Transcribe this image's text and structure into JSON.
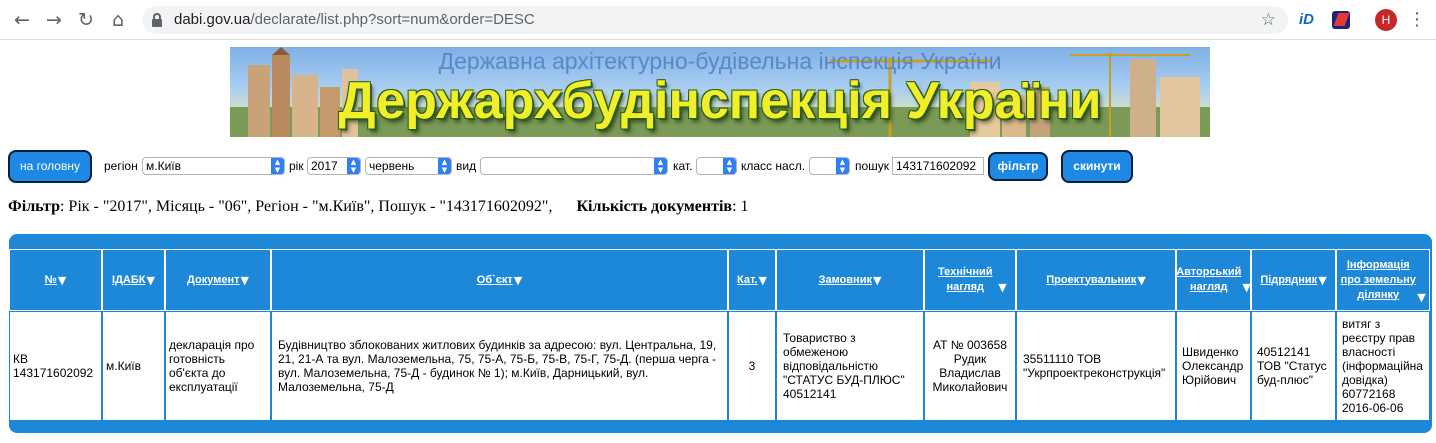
{
  "browser": {
    "url_host": "dabi.gov.ua",
    "url_path": "/declarate/list.php?sort=num&order=DESC",
    "avatar_letter": "H",
    "ext1_label": "iD"
  },
  "banner": {
    "subtitle": "Державна архітектурно-будівельна інспекція України",
    "title": "Держархбудінспекція України"
  },
  "filters": {
    "home_button": "на головну",
    "region_label": "регіон",
    "region_value": "м.Київ",
    "year_label": "рік",
    "year_value": "2017",
    "month_value": "червень",
    "kind_label": "вид",
    "kind_value": "",
    "cat_label": "кат.",
    "cat_value": "",
    "class_label": "класс насл.",
    "class_value": "",
    "search_label": "пошук",
    "search_value": "143171602092",
    "filter_button": "фільтр",
    "reset_button": "скинути"
  },
  "summary": {
    "filter_label": "Фільтр",
    "filter_text": ": Рік - \"2017\", Місяць - \"06\", Регіон - \"м.Київ\", Пошук - \"143171602092\",",
    "count_label": "Кількість документів",
    "count_value": ": 1"
  },
  "table": {
    "headers": [
      {
        "label": "№"
      },
      {
        "label": "ІДАБК"
      },
      {
        "label": "Документ"
      },
      {
        "label": "Об`єкт"
      },
      {
        "label": "Кат."
      },
      {
        "label": "Замовник"
      },
      {
        "label": "Технічний нагляд"
      },
      {
        "label": "Проектувальник"
      },
      {
        "label": "Авторський нагляд"
      },
      {
        "label": "Підрядник"
      },
      {
        "label": "Інформація про земельну ділянку"
      }
    ],
    "rows": [
      [
        "КВ 143171602092",
        "м.Київ",
        "декларація про готовність об'єкта до експлуатації",
        "Будівництво зблокованих житлових будинків за адресою: вул. Центральна, 19, 21, 21-А та вул. Малоземельна, 75, 75-А, 75-Б, 75-В, 75-Г, 75-Д. (перша черга - вул. Малоземельна, 75-Д - будинок № 1); м.Київ, Дарницький, вул. Малоземельна, 75-Д",
        "3",
        "Товариство з обмеженою відповідальністю \"СТАТУС БУД-ПЛЮС\" 40512141",
        "АТ № 003658 Рудик Владислав Миколайович",
        "35511110 ТОВ \"Укрпроектреконструкція\"",
        "Швиденко Олександр Юрійович",
        "40512141 ТОВ \"Статус буд-плюс\"",
        "витяг з реєстру прав власності (інформаційна довідка) 60772168 2016-06-06"
      ]
    ]
  }
}
